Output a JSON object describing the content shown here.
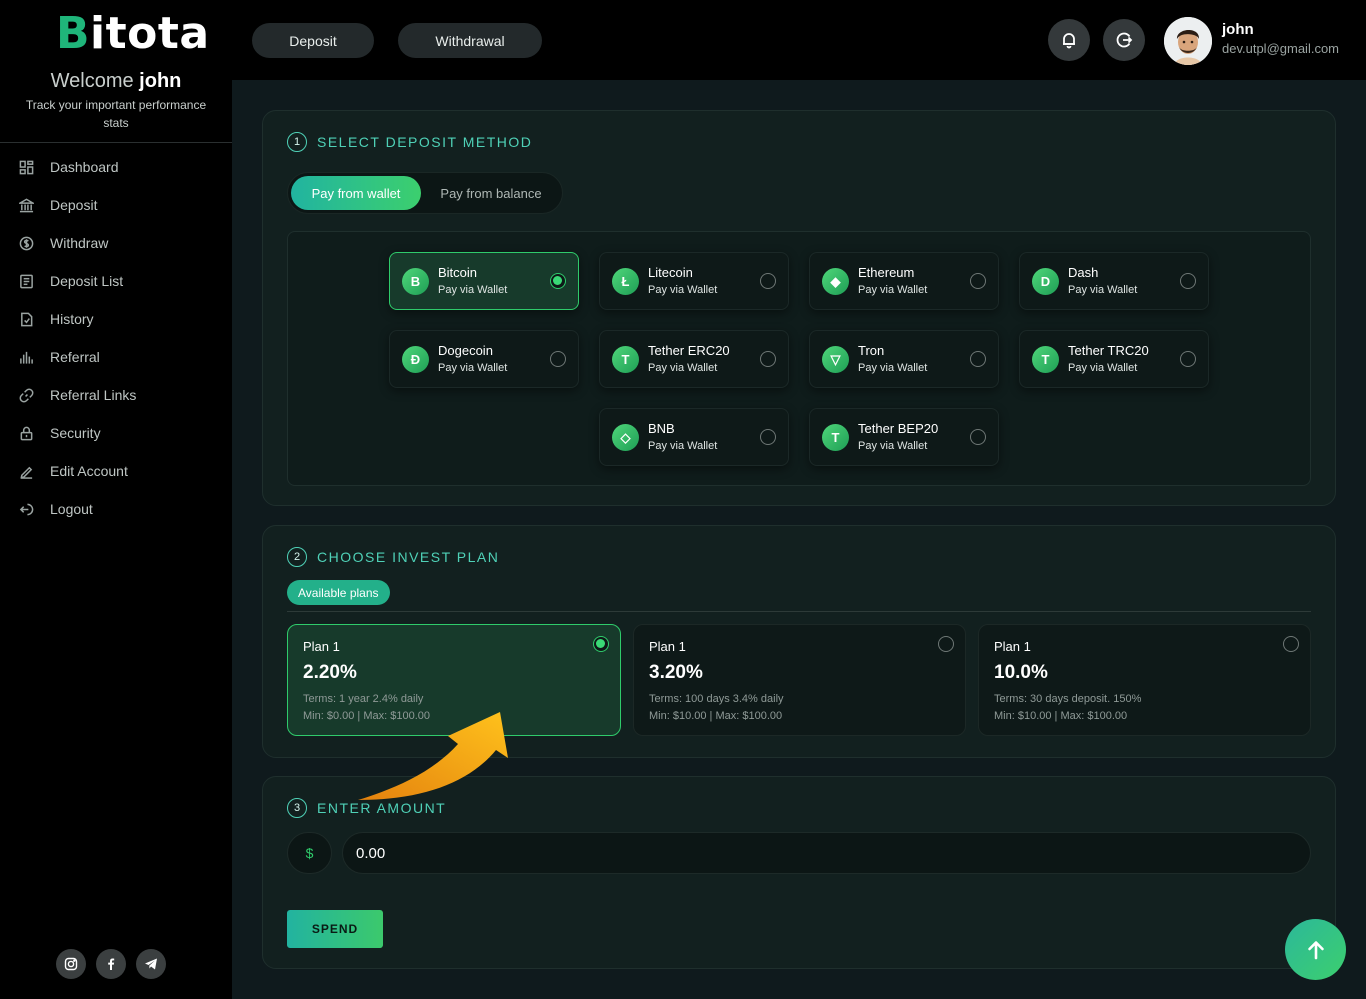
{
  "brand": {
    "logo_prefix": "B",
    "logo_rest": "itota"
  },
  "sidebar": {
    "welcome": "Welcome",
    "username": "john",
    "tagline": "Track your important performance stats",
    "items": [
      {
        "label": "Dashboard",
        "icon": "dashboard-icon"
      },
      {
        "label": "Deposit",
        "icon": "bank-icon"
      },
      {
        "label": "Withdraw",
        "icon": "dollar-circle-icon"
      },
      {
        "label": "Deposit List",
        "icon": "list-icon"
      },
      {
        "label": "History",
        "icon": "history-icon"
      },
      {
        "label": "Referral",
        "icon": "bar-chart-icon"
      },
      {
        "label": "Referral Links",
        "icon": "link-icon"
      },
      {
        "label": "Security",
        "icon": "lock-icon"
      },
      {
        "label": "Edit Account",
        "icon": "pencil-icon"
      },
      {
        "label": "Logout",
        "icon": "logout-icon"
      }
    ],
    "socials": [
      "instagram-icon",
      "facebook-icon",
      "telegram-icon"
    ]
  },
  "topbar": {
    "deposit_label": "Deposit",
    "withdrawal_label": "Withdrawal",
    "user_name": "john",
    "user_email": "dev.utpl@gmail.com"
  },
  "step1": {
    "number": "1",
    "title": "SELECT DEPOSIT METHOD",
    "pay_wallet": "Pay from wallet",
    "pay_balance": "Pay from balance",
    "coins": [
      {
        "name": "Bitcoin",
        "sub": "Pay via Wallet",
        "glyph": "B",
        "selected": true
      },
      {
        "name": "Litecoin",
        "sub": "Pay via Wallet",
        "glyph": "Ł",
        "selected": false
      },
      {
        "name": "Ethereum",
        "sub": "Pay via Wallet",
        "glyph": "◆",
        "selected": false
      },
      {
        "name": "Dash",
        "sub": "Pay via Wallet",
        "glyph": "D",
        "selected": false
      },
      {
        "name": "Dogecoin",
        "sub": "Pay via Wallet",
        "glyph": "Ð",
        "selected": false
      },
      {
        "name": "Tether ERC20",
        "sub": "Pay via Wallet",
        "glyph": "T",
        "selected": false
      },
      {
        "name": "Tron",
        "sub": "Pay via Wallet",
        "glyph": "▽",
        "selected": false
      },
      {
        "name": "Tether TRC20",
        "sub": "Pay via Wallet",
        "glyph": "T",
        "selected": false
      },
      {
        "name": "BNB",
        "sub": "Pay via Wallet",
        "glyph": "◇",
        "selected": false
      },
      {
        "name": "Tether BEP20",
        "sub": "Pay via Wallet",
        "glyph": "T",
        "selected": false
      }
    ]
  },
  "step2": {
    "number": "2",
    "title": "CHOOSE INVEST PLAN",
    "available_label": "Available plans",
    "plans": [
      {
        "name": "Plan 1",
        "rate": "2.20%",
        "terms": "Terms: 1 year 2.4% daily",
        "minmax": "Min: $0.00  |  Max: $100.00",
        "selected": true
      },
      {
        "name": "Plan 1",
        "rate": "3.20%",
        "terms": "Terms: 100 days 3.4% daily",
        "minmax": "Min: $10.00  |  Max: $100.00",
        "selected": false
      },
      {
        "name": "Plan 1",
        "rate": "10.0%",
        "terms": "Terms: 30 days deposit. 150%",
        "minmax": "Min: $10.00  |  Max: $100.00",
        "selected": false
      }
    ]
  },
  "step3": {
    "number": "3",
    "title": "ENTER AMOUNT",
    "currency_symbol": "$",
    "amount_value": "0.00",
    "spend_label": "SPEND"
  },
  "colors": {
    "accent": "#2fcb6b",
    "teal": "#4fd1b7",
    "arrow": "#f7a21b"
  }
}
